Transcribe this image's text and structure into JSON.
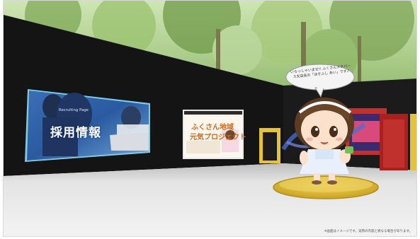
{
  "scene": {
    "recruit_screen": {
      "subtitle": "Recruiting Page",
      "title": "採用情報"
    },
    "poster": {
      "subtitle": "",
      "title_a": "ふくさん地域",
      "title_b": "元気プロジェクト"
    },
    "speech_bubble": {
      "text": "いらっしゃいませ!! ふくさんメタバース支店長の「ほぞふし あい」です♪"
    },
    "footer": {
      "note": "※画面はイメージです。実際の内容と異なる場合があります。"
    }
  },
  "colors": {
    "wall": "#141414",
    "floor": "#dcdcdc",
    "pedestal": "#e3c13a",
    "accent_red": "#c0302c",
    "accent_yellow": "#e6c13a"
  }
}
